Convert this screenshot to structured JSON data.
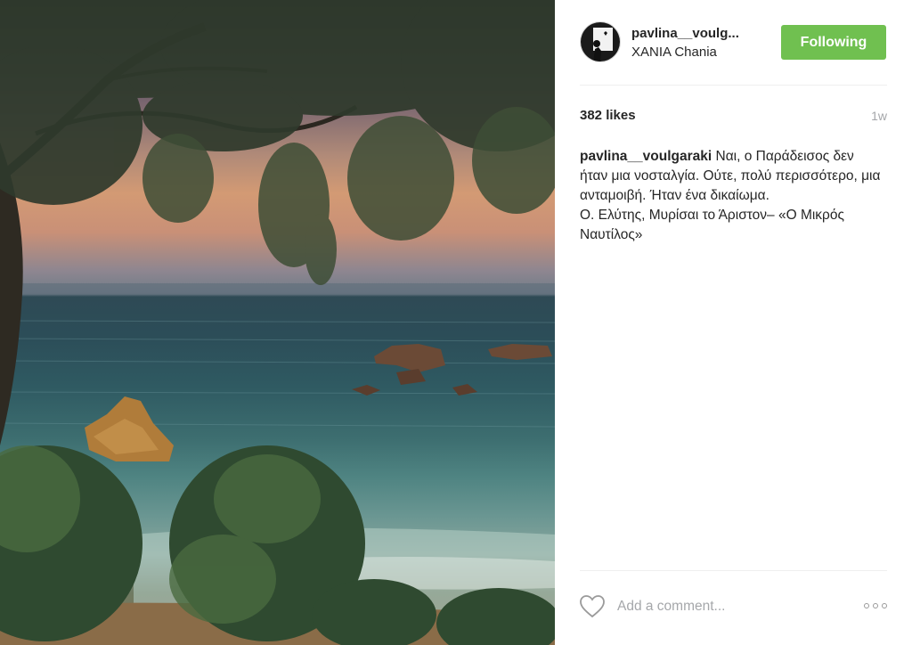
{
  "post": {
    "image_alt": "Sunset over the sea seen through tamarisk trees",
    "username_short": "pavlina__voulg...",
    "location": "ΧΑΝΙΑ Chania",
    "follow_label": "Following",
    "likes": "382 likes",
    "time_ago": "1w"
  },
  "caption": {
    "username": "pavlina__voulgaraki",
    "text": "Ναι, ο Παράδεισος δεν ήταν μια νοσταλγία. Ούτε, πολύ περισσότερο, μια ανταμοιβή. Ήταν ένα δικαίωμα.",
    "quote_source": "Ο. Ελύτης, Μυρίσαι το Άριστον– «Ο Μικρός Ναυτίλος»"
  },
  "comment": {
    "placeholder": "Add a comment..."
  },
  "icons": {
    "like": "heart-icon",
    "more": "more-options-icon"
  },
  "colors": {
    "follow_button": "#70c050",
    "secondary_text": "#a5a7aa",
    "divider": "#efefef"
  }
}
